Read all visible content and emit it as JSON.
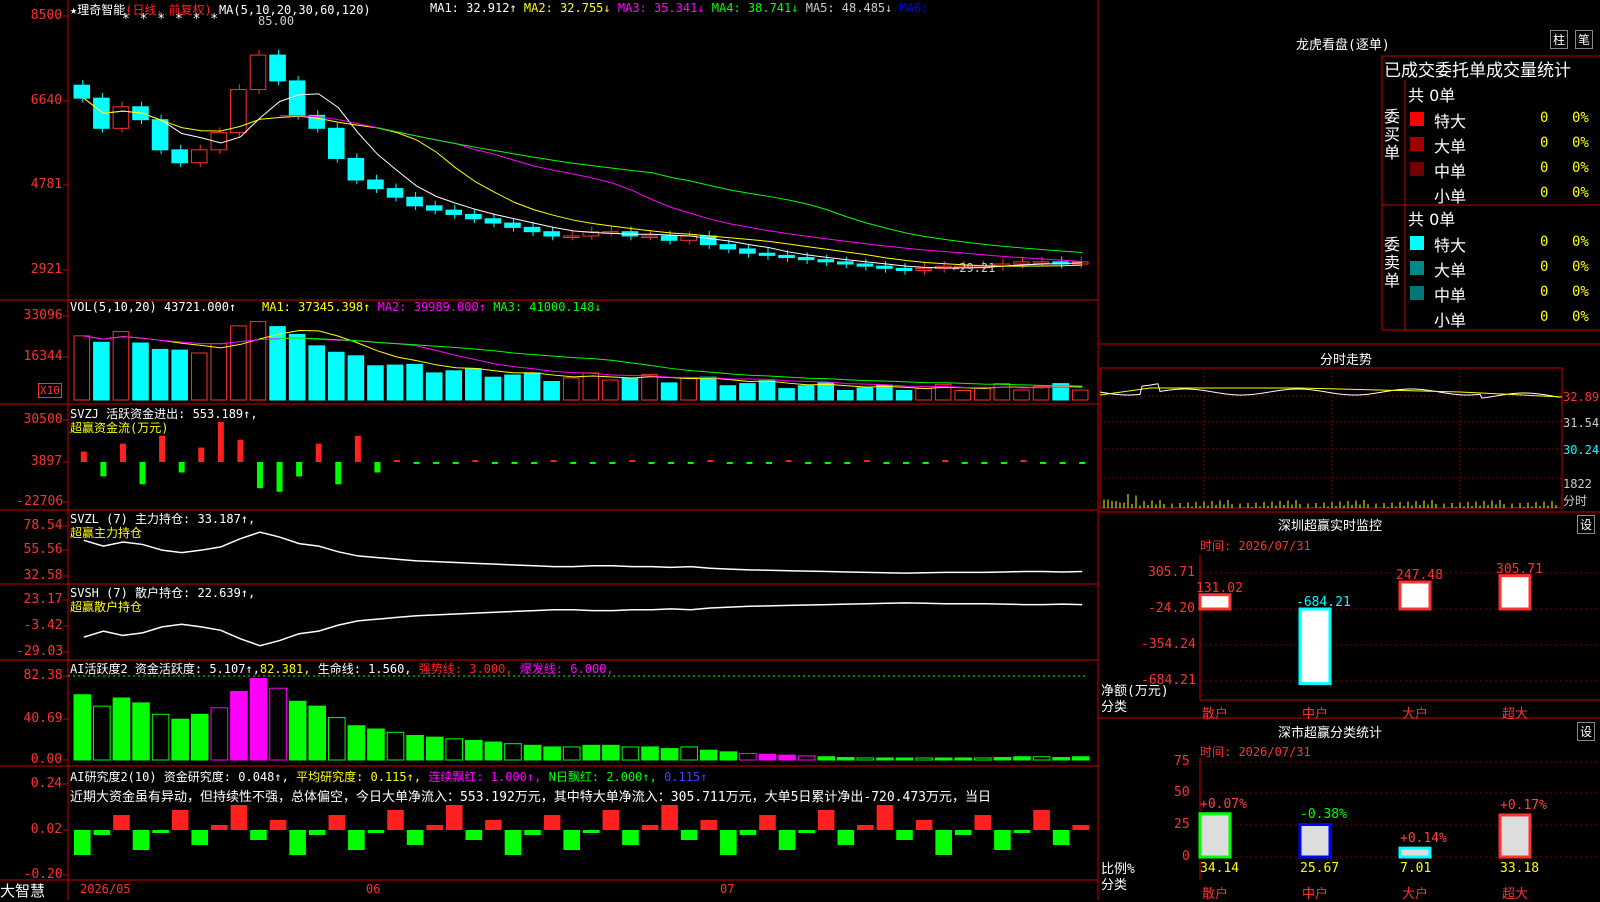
{
  "stock": {
    "name": "理奇智能",
    "period": "(日线，前复权)",
    "star": "★"
  },
  "kline": {
    "ma_label": "MA(5,10,20,30,60,120)",
    "ma": [
      {
        "t": "MA1: 32.912↑",
        "c": "#ffffff"
      },
      {
        "t": "MA2: 32.755↓",
        "c": "#ffff00"
      },
      {
        "t": "MA3: 35.341↓",
        "c": "#ff00ff"
      },
      {
        "t": "MA4: 38.741↓",
        "c": "#00ff00"
      },
      {
        "t": "MA5: 48.485↓",
        "c": "#cccccc"
      },
      {
        "t": "MA6:",
        "c": "#0000ff"
      }
    ],
    "y_ticks": [
      "8500",
      "6640",
      "4781",
      "2921"
    ],
    "high_label": "85.00",
    "low_label": "←29.21",
    "stars": "* *   * * * *"
  },
  "vol": {
    "label": "VOL(5,10,20)",
    "value": "43721.000↑",
    "ma": [
      {
        "t": "MA1: 37345.398↑",
        "c": "#ffff00"
      },
      {
        "t": "MA2: 39989.000↑",
        "c": "#ff00ff"
      },
      {
        "t": "MA3: 41000.148↓",
        "c": "#00ff00"
      }
    ],
    "y_ticks": [
      "33096",
      "16344"
    ],
    "unit": "X10"
  },
  "svzj": {
    "label": "SVZJ  活跃资金进出: 553.189↑,",
    "sub": "超赢资金流(万元)",
    "y_ticks": [
      "30500",
      "3897",
      "-22706"
    ]
  },
  "svzl": {
    "label": "SVZL (7) 主力持仓: 33.187↑,",
    "sub": "超赢主力持仓",
    "y_ticks": [
      "78.54",
      "55.56",
      "32.58"
    ]
  },
  "svsh": {
    "label": "SVSH (7) 散户持仓: 22.639↑,",
    "sub": "超赢散户持仓",
    "y_ticks": [
      "23.17",
      "-3.42",
      "-29.03"
    ]
  },
  "ai1": {
    "label": "AI活跃度2 资金活跃度: 5.107↑,",
    "v2": "82.381,",
    "v3": "生命线: 1.560,",
    "v4": "强势线: 3.000,",
    "v5": "爆发线: 6.000,",
    "y_ticks": [
      "82.38",
      "40.69",
      "0.00"
    ]
  },
  "ai2": {
    "label": "AI研究度2(10) 资金研究度: 0.048↑,",
    "v2": "平均研究度: 0.115↑,",
    "v3": "连续飘红: 1.000↑,",
    "v4": "N日飘红: 2.000↑,",
    "v5": "0.115↑",
    "note": "近期大资金虽有异动，但持续性不强，总体偏空，今日大单净流入：553.192万元，其中特大单净流入：305.711万元，大单5日累计净出-720.473万元，当日",
    "y_ticks": [
      "0.24",
      "0.02",
      "-0.20"
    ]
  },
  "dates": [
    "2026/05",
    "06",
    "07"
  ],
  "brand": "大智慧",
  "right": {
    "title": "龙虎看盘(逐单)",
    "btn1": "柱",
    "btn2": "笔",
    "stats_title": "已成交委托单成交量统计",
    "buy": {
      "side": "委买单",
      "total": "共 0单",
      "rows": [
        {
          "n": "特大",
          "c": "#ff0000",
          "v": "0",
          "p": "0%"
        },
        {
          "n": "大单",
          "c": "#a00000",
          "v": "0",
          "p": "0%"
        },
        {
          "n": "中单",
          "c": "#700000",
          "v": "0",
          "p": "0%"
        },
        {
          "n": "小单",
          "c": "#000000",
          "v": "0",
          "p": "0%"
        }
      ]
    },
    "sell": {
      "side": "委卖单",
      "total": "共 0单",
      "rows": [
        {
          "n": "特大",
          "c": "#00ffff",
          "v": "0",
          "p": "0%"
        },
        {
          "n": "大单",
          "c": "#008888",
          "v": "0",
          "p": "0%"
        },
        {
          "n": "中单",
          "c": "#007777",
          "v": "0",
          "p": "0%"
        },
        {
          "n": "小单",
          "c": "#000000",
          "v": "0",
          "p": "0%"
        }
      ]
    },
    "intraday": {
      "title": "分时走势",
      "y": [
        "32.89",
        "31.54",
        "30.24"
      ],
      "vol": "1822",
      "vol_unit": "分时"
    },
    "monitor": {
      "title": "深圳超赢实时监控",
      "btn": "设",
      "time": "时间: 2026/07/31",
      "y": [
        "305.71",
        "-24.20",
        "-354.24",
        "-684.21"
      ],
      "ylabel": "净额(万元)",
      "xlabel": "分类",
      "cats": [
        "散户",
        "中户",
        "大户",
        "超大"
      ],
      "values": [
        131.02,
        -684.21,
        247.48,
        305.71
      ],
      "labels": [
        "131.02",
        "-684.21",
        "247.48",
        "305.71"
      ]
    },
    "classify": {
      "title": "深市超赢分类统计",
      "btn": "设",
      "time": "时间: 2026/07/31",
      "y": [
        "75",
        "50",
        "25",
        "0"
      ],
      "ylabel": "比例%",
      "xlabel": "分类",
      "cats": [
        "散户",
        "中户",
        "大户",
        "超大"
      ],
      "values": [
        34.14,
        25.67,
        7.01,
        33.18
      ],
      "labels": [
        "34.14",
        "25.67",
        "7.01",
        "33.18"
      ],
      "deltas": [
        "+0.07%",
        "-0.38%",
        "+0.14%",
        "+0.17%"
      ],
      "delta_colors": [
        "#ff4040",
        "#00ff00",
        "#ff4040",
        "#ff4040"
      ]
    }
  },
  "chart_data": [
    {
      "type": "candlestick",
      "title": "理奇智能",
      "series": [
        {
          "name": "close",
          "values": [
            70,
            63,
            68,
            65,
            58,
            55,
            58,
            62,
            72,
            80,
            74,
            66,
            63,
            56,
            51,
            49,
            47,
            45,
            44,
            43,
            42,
            41,
            40,
            39,
            38,
            38,
            39,
            39,
            38,
            38,
            37,
            38,
            36,
            35,
            34,
            33.5,
            33,
            32.5,
            32,
            31.5,
            31,
            30.5,
            30,
            30.5,
            31,
            31,
            31,
            31.5,
            32,
            32,
            31.5,
            32
          ]
        }
      ],
      "ylim": [
        25,
        90
      ],
      "y_ticks": [
        85,
        66.4,
        47.81,
        29.21
      ]
    },
    {
      "type": "bar",
      "title": "VOL",
      "ylim": [
        0,
        40000
      ],
      "y_ticks": [
        33096,
        16344
      ]
    },
    {
      "type": "bar",
      "title": "SVZJ",
      "ylim": [
        -22706,
        30500
      ],
      "y_ticks": [
        30500,
        3897,
        -22706
      ]
    },
    {
      "type": "line",
      "title": "SVZL",
      "ylim": [
        32.58,
        78.54
      ],
      "y_ticks": [
        78.54,
        55.56,
        32.58
      ]
    },
    {
      "type": "line",
      "title": "SVSH",
      "ylim": [
        -29.03,
        23.17
      ],
      "y_ticks": [
        23.17,
        -3.42,
        -29.03
      ]
    },
    {
      "type": "bar",
      "title": "AI活跃度2",
      "ylim": [
        0,
        82.38
      ],
      "y_ticks": [
        82.38,
        40.69,
        0
      ]
    },
    {
      "type": "bar",
      "title": "AI研究度2",
      "ylim": [
        -0.2,
        0.24
      ],
      "y_ticks": [
        0.24,
        0.02,
        -0.2
      ]
    },
    {
      "type": "bar",
      "title": "深圳超赢实时监控",
      "categories": [
        "散户",
        "中户",
        "大户",
        "超大"
      ],
      "values": [
        131.02,
        -684.21,
        247.48,
        305.71
      ],
      "ylim": [
        -684.21,
        305.71
      ]
    },
    {
      "type": "bar",
      "title": "深市超赢分类统计",
      "categories": [
        "散户",
        "中户",
        "大户",
        "超大"
      ],
      "values": [
        34.14,
        25.67,
        7.01,
        33.18
      ],
      "ylim": [
        0,
        75
      ]
    }
  ]
}
